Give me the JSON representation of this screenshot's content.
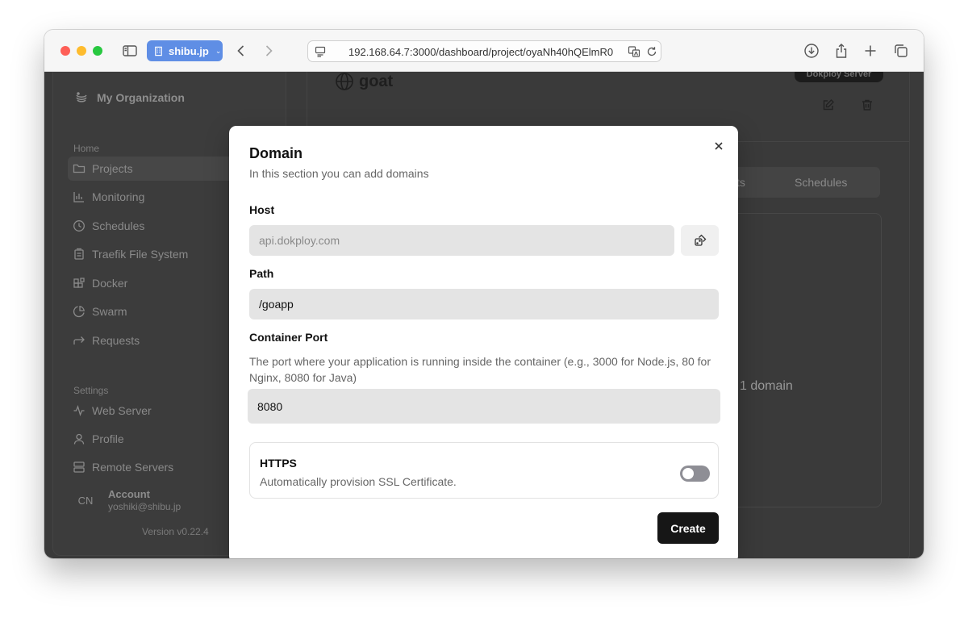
{
  "browser": {
    "tab_group_label": "shibu.jp",
    "url": "192.168.64.7:3000/dashboard/project/oyaNh40hQElmR0"
  },
  "sidebar": {
    "org_name": "My Organization",
    "sections": [
      {
        "title": "Home",
        "items": [
          "Projects",
          "Monitoring",
          "Schedules",
          "Traefik File System",
          "Docker",
          "Swarm",
          "Requests"
        ]
      },
      {
        "title": "Settings",
        "items": [
          "Web Server",
          "Profile",
          "Remote Servers"
        ]
      }
    ],
    "account": {
      "initials": "CN",
      "label": "Account",
      "email": "yoshiki@shibu.jp"
    },
    "version": "Version v0.22.4"
  },
  "main": {
    "project_name": "goat",
    "server_badge": "Dokploy Server",
    "tab_partial": "ts",
    "tab_schedules": "Schedules",
    "domain_count": "1 domain"
  },
  "modal": {
    "title": "Domain",
    "description": "In this section you can add domains",
    "host": {
      "label": "Host",
      "placeholder": "api.dokploy.com",
      "value": ""
    },
    "path": {
      "label": "Path",
      "value": "/goapp"
    },
    "port": {
      "label": "Container Port",
      "help": "The port where your application is running inside the container (e.g., 3000 for Node.js, 80 for Nginx, 8080 for Java)",
      "value": "8080"
    },
    "https": {
      "label": "HTTPS",
      "description": "Automatically provision SSL Certificate.",
      "enabled": false
    },
    "submit_label": "Create"
  }
}
